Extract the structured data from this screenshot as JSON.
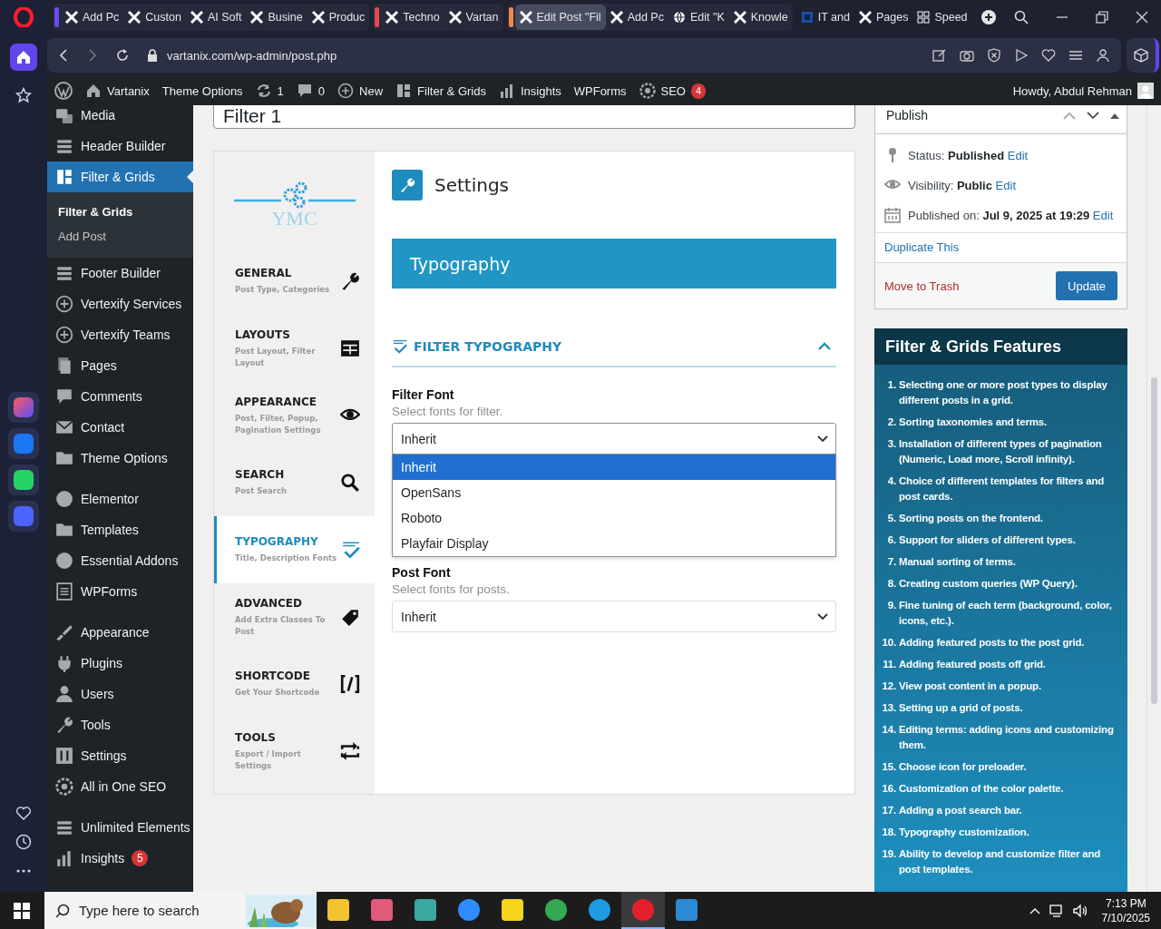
{
  "browser": {
    "rail": {
      "top": [
        {
          "kind": "home",
          "selected": true
        },
        {
          "kind": "star",
          "selected": false
        }
      ],
      "apps": [
        {
          "kind": "aria"
        },
        {
          "kind": "messenger"
        },
        {
          "kind": "whatsapp"
        },
        {
          "kind": "music"
        }
      ],
      "bottom": [
        {
          "kind": "heart"
        },
        {
          "kind": "clock"
        },
        {
          "kind": "more"
        }
      ]
    },
    "tab_groups": [
      {
        "color": "#6c4cf5",
        "tabs": [
          {
            "title": "Add Pc",
            "kind": "x",
            "selected": false
          },
          {
            "title": "Custon",
            "kind": "x",
            "selected": false
          },
          {
            "title": "AI Soft",
            "kind": "x",
            "selected": false
          },
          {
            "title": "Busine",
            "kind": "x",
            "selected": false
          },
          {
            "title": "Produc",
            "kind": "x",
            "selected": false
          }
        ]
      },
      {
        "color": "#e5484d",
        "tabs": [
          {
            "title": "Techno",
            "kind": "x",
            "selected": false
          },
          {
            "title": "Vartan",
            "kind": "x",
            "selected": false
          }
        ]
      },
      {
        "color": "#f08a4b",
        "tabs": [
          {
            "title": "Edit Post \"Fil",
            "kind": "x",
            "selected": true
          },
          {
            "title": "Add Pc",
            "kind": "x",
            "selected": false
          },
          {
            "title": "Edit \"K",
            "kind": "globe",
            "selected": false
          },
          {
            "title": "Knowle",
            "kind": "x",
            "selected": false
          }
        ]
      },
      {
        "tabs": [
          {
            "title": "IT and",
            "kind": "square",
            "selected": false
          },
          {
            "title": "Pages",
            "kind": "x",
            "selected": false
          },
          {
            "title": "Speed",
            "kind": "grid",
            "selected": false
          }
        ]
      }
    ],
    "url": "vartanix.com/wp-admin/post.php"
  },
  "admin_bar": {
    "items": [
      {
        "kind": "home",
        "label": "Vartanix"
      },
      {
        "kind": "text",
        "label": "Theme Options"
      },
      {
        "kind": "refresh",
        "label": "1"
      },
      {
        "kind": "comment",
        "label": "0"
      },
      {
        "kind": "plus",
        "label": "New"
      },
      {
        "kind": "grid",
        "label": "Filter & Grids"
      },
      {
        "kind": "bars",
        "label": "Insights"
      },
      {
        "kind": "text",
        "label": "WPForms"
      },
      {
        "kind": "gear",
        "label": "SEO",
        "badge": "4"
      }
    ],
    "user": "Howdy, Abdul Rehman"
  },
  "sidebar": {
    "groups": [
      {
        "items": [
          {
            "label": "Media",
            "kind": "media",
            "selected": false
          },
          {
            "label": "Header Builder",
            "kind": "builder",
            "selected": false
          },
          {
            "label": "Filter & Grids",
            "kind": "grid",
            "selected": true,
            "children": [
              {
                "label": "Filter & Grids",
                "selected": true
              },
              {
                "label": "Add Post",
                "selected": false
              }
            ]
          },
          {
            "label": "Footer Builder",
            "kind": "builder",
            "selected": false
          },
          {
            "label": "Vertexify Services",
            "kind": "plus",
            "selected": false
          },
          {
            "label": "Vertexify Teams",
            "kind": "plus",
            "selected": false
          },
          {
            "label": "Pages",
            "kind": "pages",
            "selected": false
          },
          {
            "label": "Comments",
            "kind": "comment",
            "selected": false
          },
          {
            "label": "Contact",
            "kind": "mail",
            "selected": false
          },
          {
            "label": "Theme Options",
            "kind": "folder",
            "selected": false
          }
        ]
      },
      {
        "items": [
          {
            "label": "Elementor",
            "kind": "circle",
            "selected": false
          },
          {
            "label": "Templates",
            "kind": "folder",
            "selected": false
          },
          {
            "label": "Essential Addons",
            "kind": "circle",
            "selected": false
          },
          {
            "label": "WPForms",
            "kind": "form",
            "selected": false
          }
        ]
      },
      {
        "items": [
          {
            "label": "Appearance",
            "kind": "brush",
            "selected": false
          },
          {
            "label": "Plugins",
            "kind": "plug",
            "selected": false
          },
          {
            "label": "Users",
            "kind": "user",
            "selected": false
          },
          {
            "label": "Tools",
            "kind": "wrench",
            "selected": false
          },
          {
            "label": "Settings",
            "kind": "sliders",
            "selected": false
          },
          {
            "label": "All in One SEO",
            "kind": "gear",
            "selected": false
          }
        ]
      },
      {
        "items": [
          {
            "label": "Unlimited Elements",
            "kind": "builder",
            "selected": false
          },
          {
            "label": "Insights",
            "kind": "bars",
            "selected": false,
            "badge": "5"
          }
        ]
      }
    ]
  },
  "editor": {
    "title_value": "Filter 1",
    "plugin": {
      "logo_text": "YMC",
      "tabs": [
        {
          "title": "GENERAL",
          "subtitle": "Post Type, Categories",
          "kind": "wrench",
          "selected": false
        },
        {
          "title": "LAYOUTS",
          "subtitle": "Post Layout, Filter Layout",
          "kind": "table",
          "selected": false
        },
        {
          "title": "APPEARANCE",
          "subtitle": "Post, Filter, Popup, Pagination Settings",
          "kind": "eye",
          "selected": false
        },
        {
          "title": "SEARCH",
          "subtitle": "Post Search",
          "kind": "search",
          "selected": false
        },
        {
          "title": "TYPOGRAPHY",
          "subtitle": "Title, Description Fonts",
          "kind": "abc",
          "selected": true
        },
        {
          "title": "ADVANCED",
          "subtitle": "Add Extra Classes To Post",
          "kind": "tag",
          "selected": false
        },
        {
          "title": "SHORTCODE",
          "subtitle": "Get Your Shortcode",
          "kind": "code",
          "selected": false
        },
        {
          "title": "TOOLS",
          "subtitle": "Export / Import Settings",
          "kind": "swap",
          "selected": false
        }
      ],
      "heading": "Settings",
      "banner": "Typography",
      "section": {
        "title": "FILTER TYPOGRAPHY",
        "expanded": true
      },
      "fields": [
        {
          "label": "Filter Font",
          "hint": "Select fonts for filter.",
          "value": "Inherit",
          "open": true,
          "options": [
            {
              "label": "Inherit",
              "selected": true
            },
            {
              "label": "OpenSans",
              "selected": false
            },
            {
              "label": "Roboto",
              "selected": false
            },
            {
              "label": "Playfair Display",
              "selected": false
            }
          ]
        },
        {
          "label": "Post Font",
          "hint": "Select fonts for posts.",
          "value": "Inherit",
          "open": false
        }
      ]
    }
  },
  "publish": {
    "title": "Publish",
    "rows": [
      {
        "kind": "pin",
        "label": "Status:",
        "value": "Published",
        "link": "Edit"
      },
      {
        "kind": "eye",
        "label": "Visibility:",
        "value": "Public",
        "link": "Edit"
      },
      {
        "kind": "calendar",
        "label": "Published on:",
        "value": "Jul 9, 2025 at 19:29",
        "link": "Edit"
      }
    ],
    "duplicate": "Duplicate This",
    "trash": "Move to Trash",
    "update": "Update"
  },
  "features": {
    "title": "Filter & Grids Features",
    "items": [
      {
        "n": "1.",
        "text": "Selecting one or more post types to display different posts in a grid."
      },
      {
        "n": "2.",
        "text": "Sorting taxonomies and terms."
      },
      {
        "n": "3.",
        "text": "Installation of different types of pagination (Numeric, Load more, Scroll infinity)."
      },
      {
        "n": "4.",
        "text": "Choice of different templates for filters and post cards."
      },
      {
        "n": "5.",
        "text": "Sorting posts on the frontend."
      },
      {
        "n": "6.",
        "text": "Support for sliders of different types."
      },
      {
        "n": "7.",
        "text": "Manual sorting of terms."
      },
      {
        "n": "8.",
        "text": "Creating custom queries (WP Query)."
      },
      {
        "n": "9.",
        "text": "Fine tuning of each term (background, color, icons, etc.)."
      },
      {
        "n": "10.",
        "text": "Adding featured posts to the post grid."
      },
      {
        "n": "11.",
        "text": "Adding featured posts off grid."
      },
      {
        "n": "12.",
        "text": "View post content in a popup."
      },
      {
        "n": "13.",
        "text": "Setting up a grid of posts."
      },
      {
        "n": "14.",
        "text": "Editing terms: adding icons and customizing them."
      },
      {
        "n": "15.",
        "text": "Choose icon for preloader."
      },
      {
        "n": "16.",
        "text": "Customization of the color palette."
      },
      {
        "n": "17.",
        "text": "Adding a post search bar."
      },
      {
        "n": "18.",
        "text": "Typography customization."
      },
      {
        "n": "19.",
        "text": "Ability to develop and customize filter and post templates."
      }
    ]
  },
  "taskbar": {
    "search_placeholder": "Type here to search",
    "apps": [
      {
        "kind": "folder",
        "selected": false
      },
      {
        "kind": "snip",
        "selected": false
      },
      {
        "kind": "hex",
        "selected": false
      },
      {
        "kind": "zoom",
        "selected": false
      },
      {
        "kind": "note",
        "selected": false
      },
      {
        "kind": "chrome",
        "selected": false
      },
      {
        "kind": "edge",
        "selected": false
      },
      {
        "kind": "opera",
        "selected": true
      },
      {
        "kind": "code",
        "selected": false
      }
    ],
    "time": "7:13 PM",
    "date": "7/10/2025"
  }
}
